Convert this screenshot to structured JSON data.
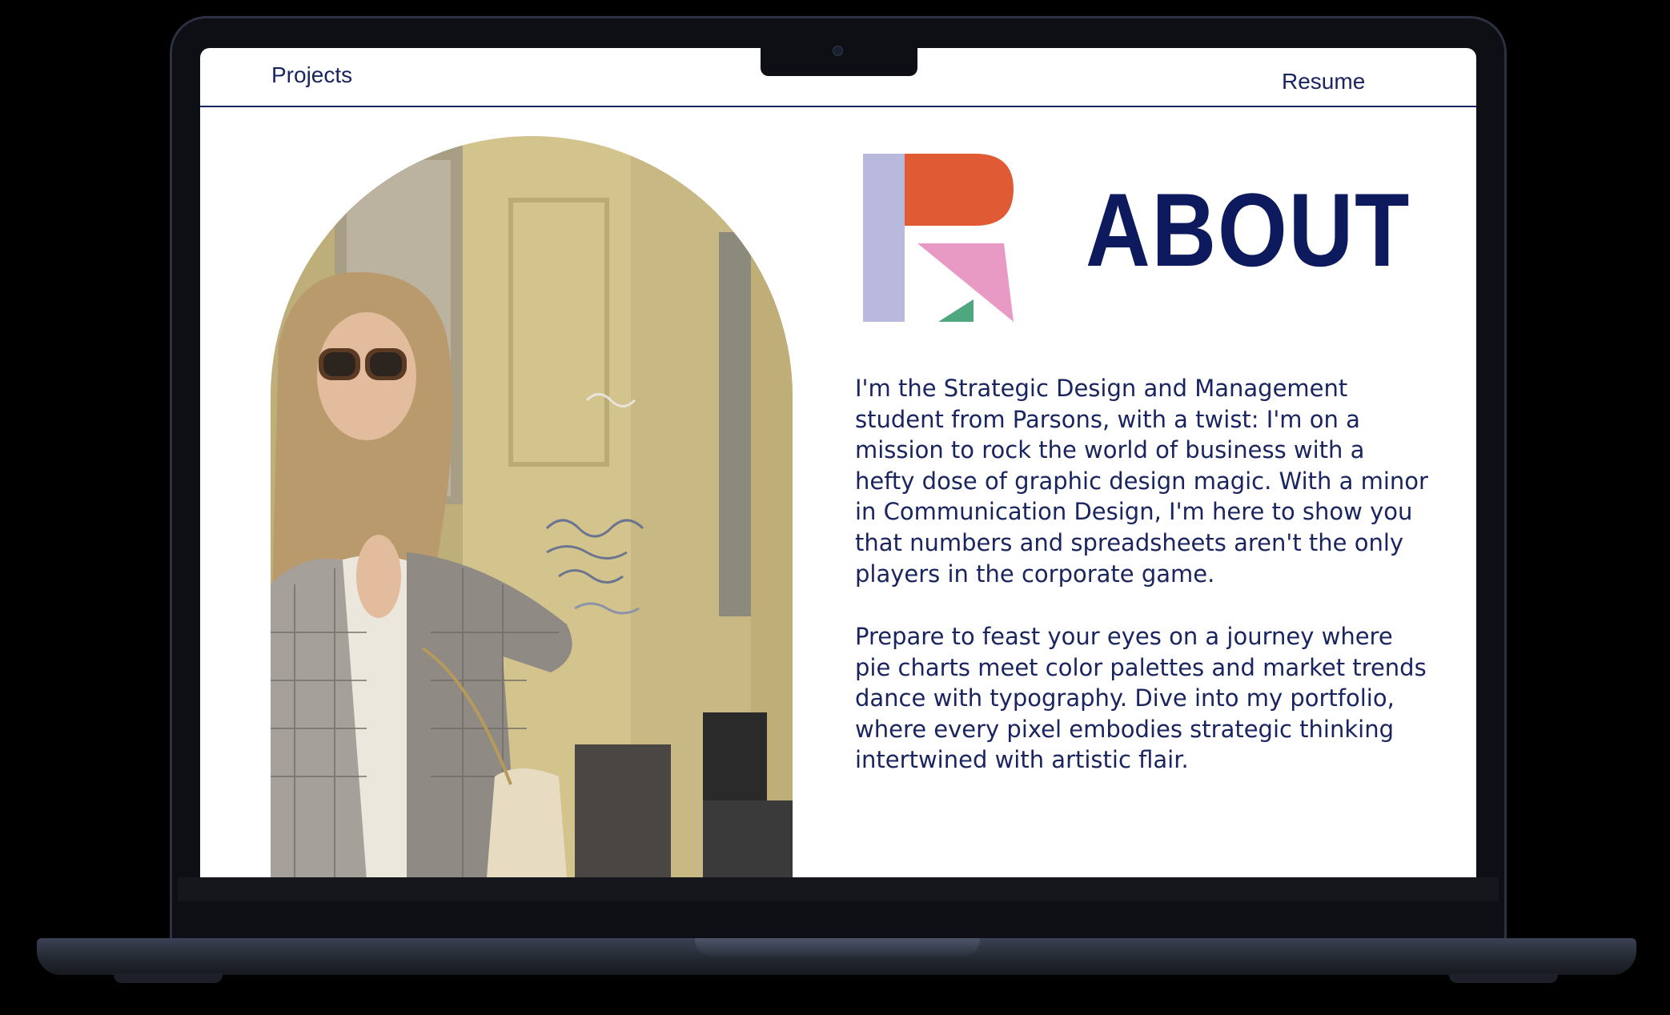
{
  "nav": {
    "projects_label": "Projects",
    "resume_label": "Resume"
  },
  "about": {
    "title": "ABOUT",
    "paragraph_1": "I'm the Strategic Design and Management student from Parsons, with a twist: I'm on a mission to rock the world of business with a hefty dose of graphic design magic. With a minor in Communication Design, I'm here to show you that numbers and spreadsheets aren't the only players in the corporate game.",
    "paragraph_2": "Prepare to feast your eyes on a journey where pie charts meet color palettes and market trends dance with typography. Dive into my portfolio, where every pixel embodies strategic thinking intertwined with artistic flair."
  },
  "logo": {
    "icon": "r-monogram-logo",
    "colors": {
      "lavender": "#b9b9dd",
      "orange": "#e05a33",
      "pink": "#e99ac4",
      "green": "#4fa77f"
    }
  },
  "colors": {
    "navy": "#1a2560",
    "title_navy": "#0e1a5e",
    "screen_bg": "#ffffff",
    "device": "#1c2029"
  }
}
